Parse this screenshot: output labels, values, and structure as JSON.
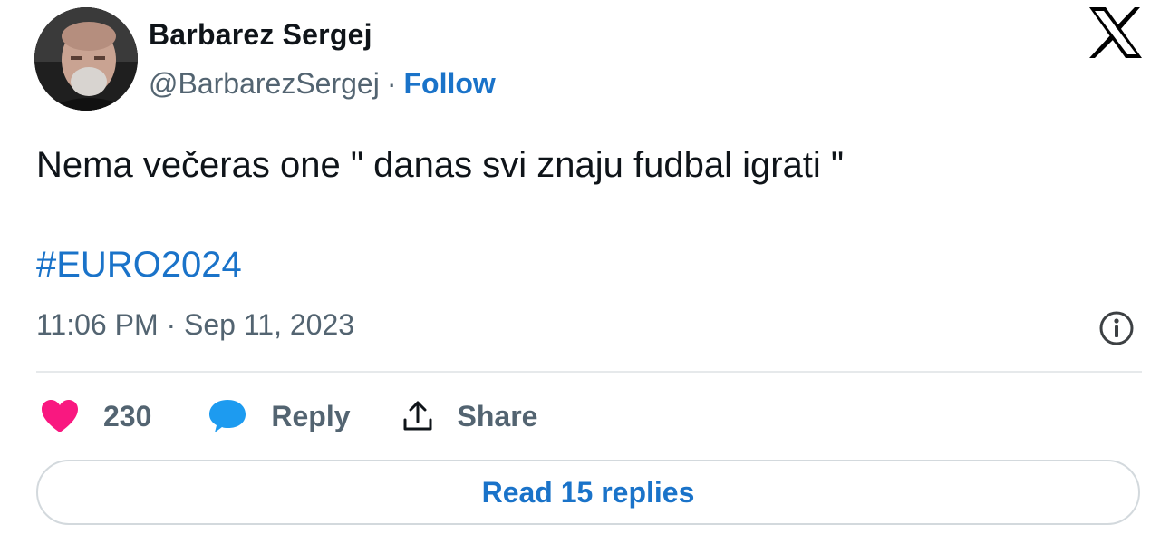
{
  "author": {
    "display_name": "Barbarez Sergej",
    "handle": "@BarbarezSergej",
    "separator": "·",
    "follow_label": "Follow",
    "avatar_icon": "avatar-photo"
  },
  "brand": {
    "logo_icon": "x-logo-icon"
  },
  "tweet": {
    "text": "Nema večeras one \" danas svi znaju fudbal igrati \"",
    "hashtag": "#EURO2024",
    "timestamp": "11:06 PM · Sep 11, 2023"
  },
  "actions": {
    "like_count": "230",
    "reply_label": "Reply",
    "share_label": "Share"
  },
  "footer": {
    "read_replies_label": "Read 15 replies"
  },
  "colors": {
    "link_blue": "#1a73c9",
    "heart_pink": "#f91880",
    "reply_bubble_blue": "#1d9bf0",
    "muted_gray": "#536471",
    "text_dark": "#0f1419"
  }
}
